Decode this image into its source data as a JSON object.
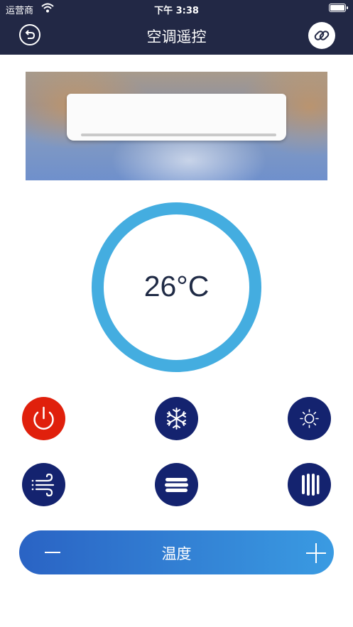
{
  "status_bar": {
    "carrier": "运营商",
    "time": "下午 3:38"
  },
  "nav": {
    "title": "空调遥控",
    "back_icon": "back-arrow-icon",
    "link_icon": "link-icon"
  },
  "display": {
    "temperature": "26°C"
  },
  "controls": [
    {
      "name": "power",
      "icon": "power-icon",
      "color": "#e0200c"
    },
    {
      "name": "cool",
      "icon": "snowflake-icon",
      "color": "#14236f"
    },
    {
      "name": "heat",
      "icon": "sun-icon",
      "color": "#14236f"
    },
    {
      "name": "wind",
      "icon": "wind-icon",
      "color": "#14236f"
    },
    {
      "name": "swing-horizontal",
      "icon": "horizontal-swing-icon",
      "color": "#14236f"
    },
    {
      "name": "swing-vertical",
      "icon": "vertical-swing-icon",
      "color": "#14236f"
    }
  ],
  "temp_control": {
    "label": "温度",
    "decrease_icon": "minus-icon",
    "increase_icon": "plus-icon"
  },
  "colors": {
    "navbar": "#222845",
    "ring": "#44ade0",
    "button": "#14236f",
    "power": "#e0200c",
    "bar_start": "#2a63c4",
    "bar_end": "#3a9be2"
  }
}
